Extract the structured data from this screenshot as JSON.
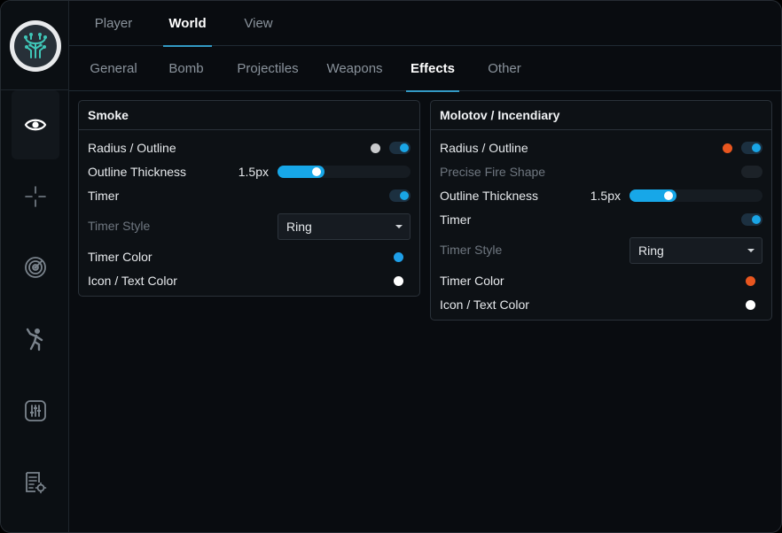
{
  "colors": {
    "accent": "#19a5e6",
    "smoke_outline_dot": "#c9cbcd",
    "molotov_outline_dot": "#e8561f",
    "smoke_timer_color": "#1e9fe8",
    "molotov_timer_color": "#e8561f",
    "icon_text_color": "#ffffff"
  },
  "sidebar": {
    "items": [
      {
        "icon": "eye-icon",
        "active": true
      },
      {
        "icon": "crosshair-icon",
        "active": false
      },
      {
        "icon": "radar-icon",
        "active": false
      },
      {
        "icon": "figure-icon",
        "active": false
      },
      {
        "icon": "sliders-icon",
        "active": false
      },
      {
        "icon": "settings-list-icon",
        "active": false
      }
    ]
  },
  "tabs": [
    {
      "label": "Player",
      "active": false
    },
    {
      "label": "World",
      "active": true
    },
    {
      "label": "View",
      "active": false
    }
  ],
  "subtabs": [
    {
      "label": "General",
      "active": false
    },
    {
      "label": "Bomb",
      "active": false
    },
    {
      "label": "Projectiles",
      "active": false
    },
    {
      "label": "Weapons",
      "active": false
    },
    {
      "label": "Effects",
      "active": true
    },
    {
      "label": "Other",
      "active": false
    }
  ],
  "smoke": {
    "title": "Smoke",
    "radius_outline": {
      "label": "Radius / Outline",
      "enabled": true
    },
    "outline_thickness": {
      "label": "Outline Thickness",
      "value_text": "1.5px",
      "fraction": 0.3
    },
    "timer": {
      "label": "Timer",
      "enabled": true
    },
    "timer_style": {
      "label": "Timer Style",
      "value": "Ring"
    },
    "timer_color": {
      "label": "Timer Color"
    },
    "icon_text_color": {
      "label": "Icon / Text Color"
    }
  },
  "molotov": {
    "title": "Molotov / Incendiary",
    "radius_outline": {
      "label": "Radius / Outline",
      "enabled": true
    },
    "precise_fire_shape": {
      "label": "Precise Fire Shape",
      "enabled": false
    },
    "outline_thickness": {
      "label": "Outline Thickness",
      "value_text": "1.5px",
      "fraction": 0.3
    },
    "timer": {
      "label": "Timer",
      "enabled": true
    },
    "timer_style": {
      "label": "Timer Style",
      "value": "Ring"
    },
    "timer_color": {
      "label": "Timer Color"
    },
    "icon_text_color": {
      "label": "Icon / Text Color"
    }
  }
}
